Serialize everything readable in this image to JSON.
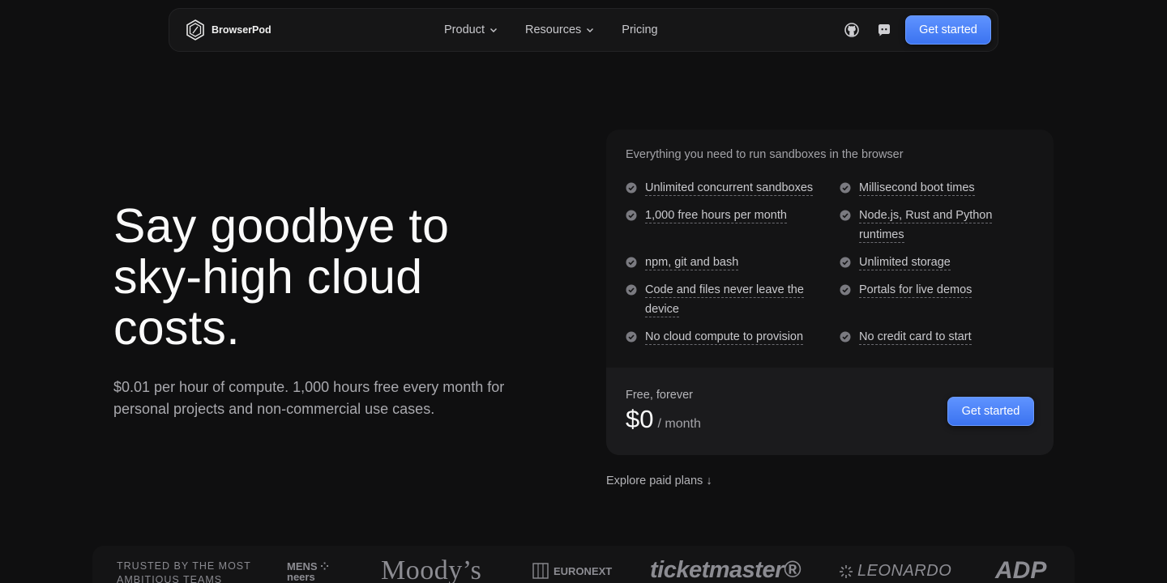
{
  "nav": {
    "brand": "BrowserPod",
    "links": [
      {
        "label": "Product"
      },
      {
        "label": "Resources"
      },
      {
        "label": "Pricing"
      }
    ],
    "cta_label": "Get started"
  },
  "hero": {
    "title": "Say goodbye to sky-high cloud costs.",
    "subtitle": "$0.01 per hour of compute. 1,000 hours free every month for personal projects and non-commercial use cases."
  },
  "plan_card": {
    "heading": "Everything you need to run sandboxes in the browser",
    "features": [
      "Unlimited concurrent sandboxes",
      "Millisecond boot times",
      "1,000 free hours per month",
      "Node.js, Rust and Python runtimes",
      "npm, git and bash",
      "Unlimited storage",
      "Code and files never leave the device",
      "Portals for live demos",
      "No cloud compute to provision",
      "No credit card to start"
    ],
    "plan_name": "Free, forever",
    "price": "$0",
    "price_period": "/ month",
    "cta_label": "Get started"
  },
  "explore_label": "Explore paid plans ↓",
  "logos": {
    "trusted_label": "TRUSTED BY THE MOST AMBITIOUS TEAMS",
    "items": [
      "MENS\nneers",
      "Moody’s",
      "EURONEXT",
      "ticketmaster®",
      "LEONARDO",
      "ADP"
    ]
  },
  "colors": {
    "accent": "#4a82f7",
    "background": "#0f0f10",
    "card": "#141415"
  }
}
